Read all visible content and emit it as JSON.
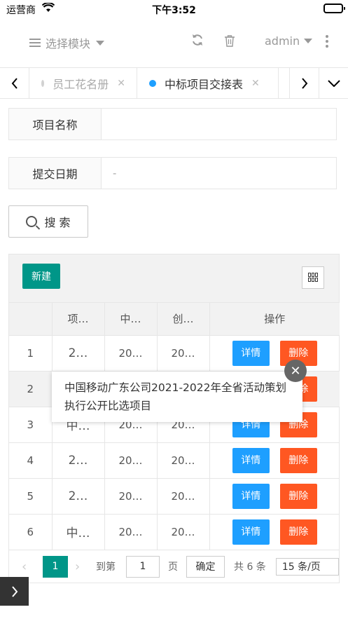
{
  "status": {
    "carrier": "运营商",
    "time": "下午3:52"
  },
  "header": {
    "module_label": "选择模块",
    "user": "admin"
  },
  "tabs": [
    {
      "label": "员工花名册",
      "active": false
    },
    {
      "label": "中标项目交接表",
      "active": true
    }
  ],
  "filters": {
    "project_name_label": "项目名称",
    "project_name_value": "",
    "submit_date_label": "提交日期",
    "submit_date_value": "-"
  },
  "search_label": "搜 索",
  "toolbar": {
    "new_label": "新建"
  },
  "table": {
    "headers": [
      "",
      "项…",
      "中…",
      "创…",
      "操作"
    ],
    "rows": [
      {
        "no": "1",
        "c1": "2…",
        "c2": "20…",
        "c3": "20…"
      },
      {
        "no": "2",
        "c1": "",
        "c2": "",
        "c3": ""
      },
      {
        "no": "3",
        "c1": "中…",
        "c2": "20…",
        "c3": "20…"
      },
      {
        "no": "4",
        "c1": "2…",
        "c2": "20…",
        "c3": "20…"
      },
      {
        "no": "5",
        "c1": "2…",
        "c2": "20…",
        "c3": "20…"
      },
      {
        "no": "6",
        "c1": "中…",
        "c2": "20…",
        "c3": "20…"
      }
    ],
    "detail_label": "详情",
    "delete_label": "删除"
  },
  "pager": {
    "current": "1",
    "goto_label": "到第",
    "goto_value": "1",
    "page_unit": "页",
    "confirm_label": "确定",
    "total": "共 6 条",
    "page_size": "15 条/页"
  },
  "tooltip": {
    "text": "中国移动广东公司2021-2022年全省活动策划执行公开比选项目"
  }
}
